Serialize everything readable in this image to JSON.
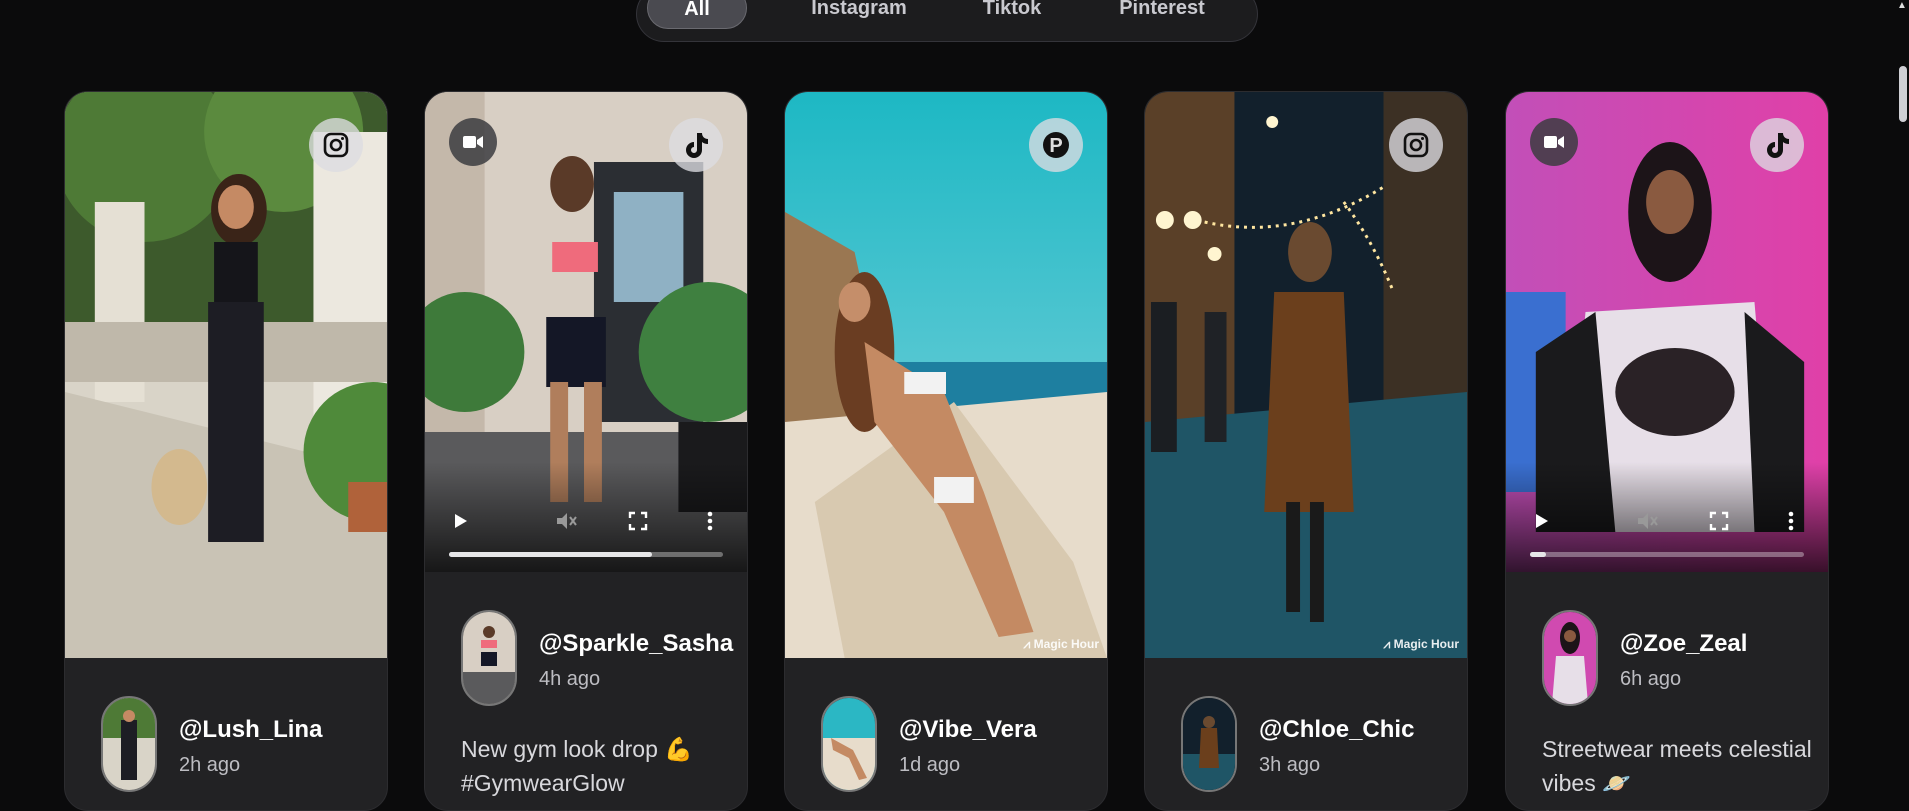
{
  "filters": {
    "tabs": [
      {
        "label": "All",
        "active": true
      },
      {
        "label": "Instagram",
        "active": false
      },
      {
        "label": "Tiktok",
        "active": false
      },
      {
        "label": "Pinterest",
        "active": false
      }
    ]
  },
  "cards": [
    {
      "handle": "@Lush_Lina",
      "time": "2h ago",
      "platform": "instagram-icon",
      "is_video": false,
      "caption": ""
    },
    {
      "handle": "@Sparkle_Sasha",
      "time": "4h ago",
      "platform": "tiktok-icon",
      "is_video": true,
      "progress": 0.74,
      "caption": "New gym look drop 💪 #GymwearGlow"
    },
    {
      "handle": "@Vibe_Vera",
      "time": "1d ago",
      "platform": "pinterest-icon",
      "is_video": false,
      "watermark": "Magic Hour",
      "caption": ""
    },
    {
      "handle": "@Chloe_Chic",
      "time": "3h ago",
      "platform": "instagram-icon",
      "is_video": false,
      "watermark": "Magic Hour",
      "caption": ""
    },
    {
      "handle": "@Zoe_Zeal",
      "time": "6h ago",
      "platform": "tiktok-icon",
      "is_video": true,
      "progress": 0.06,
      "caption": "Streetwear meets celestial vibes 🪐"
    }
  ],
  "colors": {
    "background": "#0b0b0c",
    "card": "#222224",
    "accent_bar": "#4a4a50"
  }
}
